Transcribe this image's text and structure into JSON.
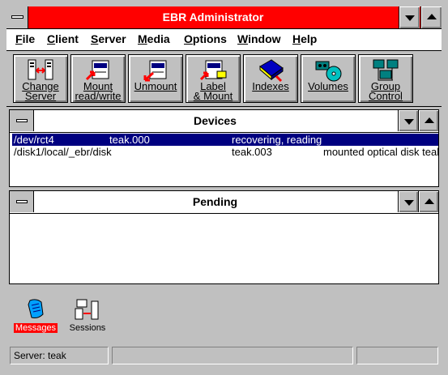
{
  "window": {
    "title": "EBR Administrator"
  },
  "menu": [
    {
      "label": "File",
      "u": "F",
      "rest": "ile"
    },
    {
      "label": "Client",
      "u": "C",
      "rest": "lient"
    },
    {
      "label": "Server",
      "u": "S",
      "rest": "erver"
    },
    {
      "label": "Media",
      "u": "M",
      "rest": "edia"
    },
    {
      "label": "Options",
      "u": "O",
      "rest": "ptions"
    },
    {
      "label": "Window",
      "u": "W",
      "rest": "indow"
    },
    {
      "label": "Help",
      "u": "H",
      "rest": "elp"
    }
  ],
  "toolbar": [
    {
      "label": "Change\nServer",
      "icon": "change-server-icon"
    },
    {
      "label": "Mount\nread/write",
      "icon": "mount-icon"
    },
    {
      "label": "Unmount",
      "icon": "unmount-icon"
    },
    {
      "label": "Label\n& Mount",
      "icon": "label-mount-icon"
    },
    {
      "label": "Indexes",
      "icon": "indexes-book-icon"
    },
    {
      "label": "Volumes",
      "icon": "volumes-tape-icon"
    },
    {
      "label": "Group\nControl",
      "icon": "group-control-icon"
    }
  ],
  "devices": {
    "title": "Devices",
    "rows": [
      {
        "path": "/dev/rct4",
        "volume": "teak.000",
        "status": "recovering, reading",
        "selected": true
      },
      {
        "path": "/disk1/local/_ebr/disk",
        "volume": "teak.003",
        "status": "mounted optical disk teak",
        "selected": false
      }
    ]
  },
  "pending": {
    "title": "Pending"
  },
  "desktop_icons": [
    {
      "label": "Messages",
      "icon": "messages-scroll-icon",
      "active": true
    },
    {
      "label": "Sessions",
      "icon": "sessions-computers-icon",
      "active": false
    }
  ],
  "status": {
    "server": "Server: teak"
  },
  "colors": {
    "titlebar": "#ff0000",
    "selection": "#000080"
  }
}
